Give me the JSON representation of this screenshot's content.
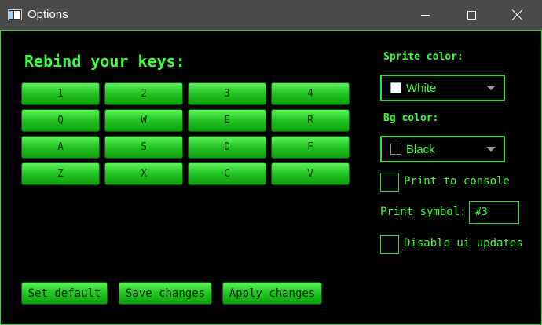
{
  "window": {
    "title": "Options"
  },
  "heading": "Rebind your keys:",
  "keys": [
    [
      "1",
      "2",
      "3",
      "4"
    ],
    [
      "Q",
      "W",
      "E",
      "R"
    ],
    [
      "A",
      "S",
      "D",
      "F"
    ],
    [
      "Z",
      "X",
      "C",
      "V"
    ]
  ],
  "actions": {
    "set_default": "Set default",
    "save_changes": "Save changes",
    "apply_changes": "Apply changes"
  },
  "sprite_color": {
    "label": "Sprite color:",
    "value": "White",
    "swatch": "#ffffff"
  },
  "bg_color": {
    "label": "Bg color:",
    "value": "Black",
    "swatch": "#000000"
  },
  "print_to_console": {
    "label": "Print to console",
    "checked": false
  },
  "print_symbol": {
    "label": "Print symbol:",
    "value": "#3"
  },
  "disable_ui_updates": {
    "label": "Disable ui updates",
    "checked": false
  },
  "colors": {
    "accent": "#3cff3c",
    "border": "#3dd63d",
    "titlebar": "#4a4a4a",
    "background": "#000000"
  }
}
